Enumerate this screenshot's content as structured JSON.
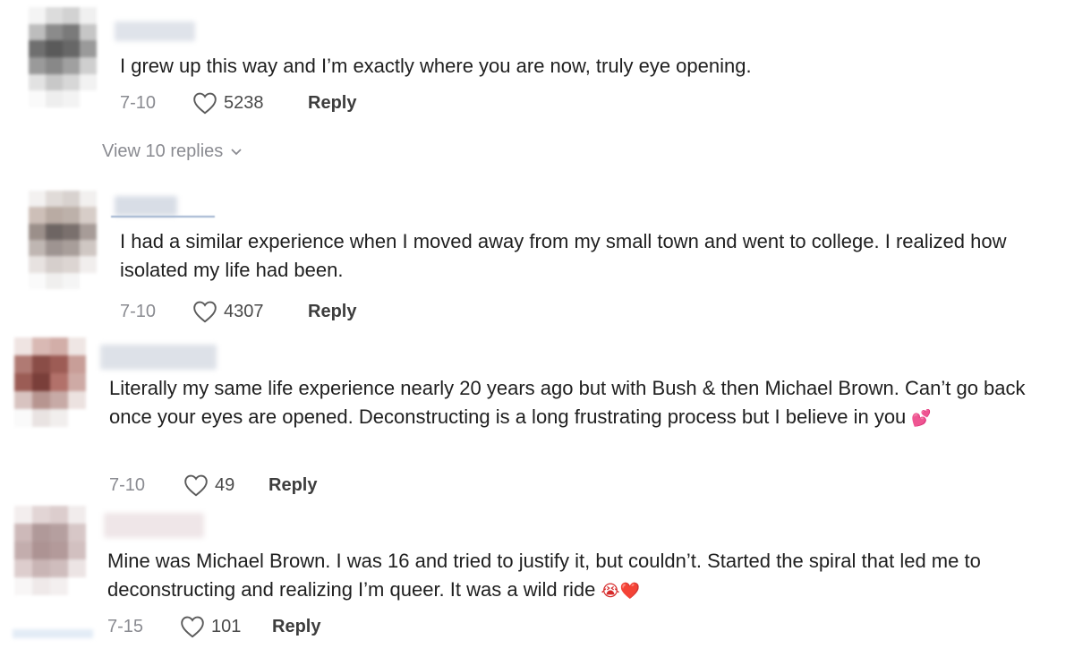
{
  "comments": [
    {
      "text": "I grew up this way and I’m exactly where you are now, truly eye opening.",
      "date": "7-10",
      "likes": "5238",
      "reply_label": "Reply",
      "view_replies": "View 10 replies",
      "avatar_color": "#8e8e8e"
    },
    {
      "text": "I had a similar experience when I moved away from my small town and went to college. I realized how isolated my life had been.",
      "date": "7-10",
      "likes": "4307",
      "reply_label": "Reply",
      "avatar_color": "#a79a94"
    },
    {
      "text": "Literally my same life experience nearly 20 years ago but with Bush & then Michael Brown. Can’t go back once your eyes are opened. Deconstructing is a long frustrating process but I believe in you",
      "date": "7-10",
      "likes": "49",
      "reply_label": "Reply",
      "emoji": "💕",
      "avatar_color": "#9b5b55"
    },
    {
      "text": "Mine was Michael Brown. I was 16 and tried to justify it, but couldn’t. Started the spiral that led me to deconstructing and realizing I’m queer. It was a wild ride",
      "date": "7-15",
      "likes": "101",
      "reply_label": "Reply",
      "emoji": "😭❤️",
      "avatar_color": "#b5a1a1"
    }
  ],
  "icons": {
    "like": "heart-outline-icon",
    "expand": "chevron-down-icon"
  },
  "colors": {
    "text": "#1f1f1f",
    "muted": "#8a8b91",
    "reply": "#3d3d3d"
  }
}
